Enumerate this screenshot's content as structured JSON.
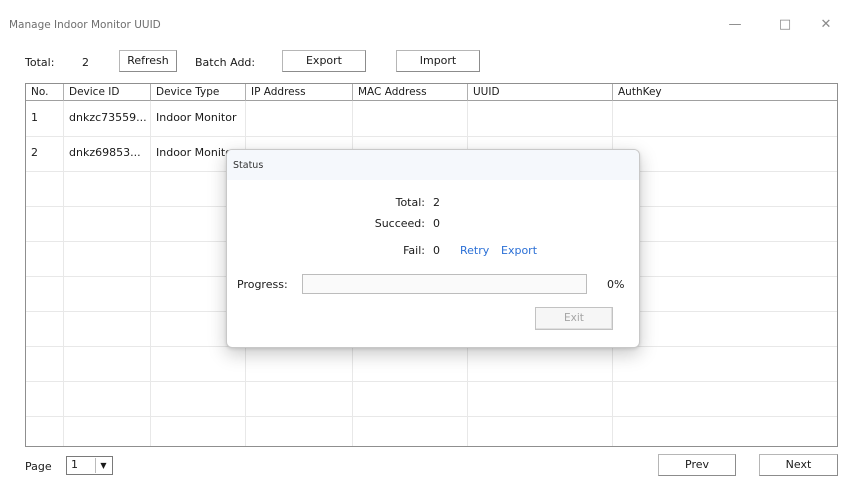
{
  "window": {
    "title": "Manage Indoor Monitor UUID",
    "controls": {
      "minimize": "—",
      "maximize": "□",
      "close": "✕"
    }
  },
  "toolbar": {
    "total_label": "Total:",
    "total_value": "2",
    "refresh_label": "Refresh",
    "batch_add_label": "Batch Add:",
    "export_label": "Export",
    "import_label": "Import"
  },
  "table": {
    "columns": [
      "No.",
      "Device ID",
      "Device Type",
      "IP Address",
      "MAC Address",
      "UUID",
      "AuthKey"
    ],
    "rows": [
      {
        "no": "1",
        "device_id": "dnkzc73559...",
        "device_type": "Indoor Monitor",
        "ip": "",
        "mac": "",
        "uuid": "",
        "authkey": ""
      },
      {
        "no": "2",
        "device_id": "dnkz69853...",
        "device_type": "Indoor Monitor",
        "ip": "",
        "mac": "",
        "uuid": "",
        "authkey": ""
      }
    ]
  },
  "footer": {
    "page_label": "Page",
    "page_value": "1",
    "prev_label": "Prev",
    "next_label": "Next"
  },
  "dialog": {
    "title": "Status",
    "total_label": "Total:",
    "total_value": "2",
    "succeed_label": "Succeed:",
    "succeed_value": "0",
    "fail_label": "Fail:",
    "fail_value": "0",
    "retry_label": "Retry",
    "export_label": "Export",
    "progress_label": "Progress:",
    "progress_value": 0,
    "progress_text": "0%",
    "exit_label": "Exit"
  },
  "colors": {
    "link": "#2a6fd6",
    "progress_fill": "#06b025",
    "dialog_title_bg": "#f5f8fc"
  }
}
